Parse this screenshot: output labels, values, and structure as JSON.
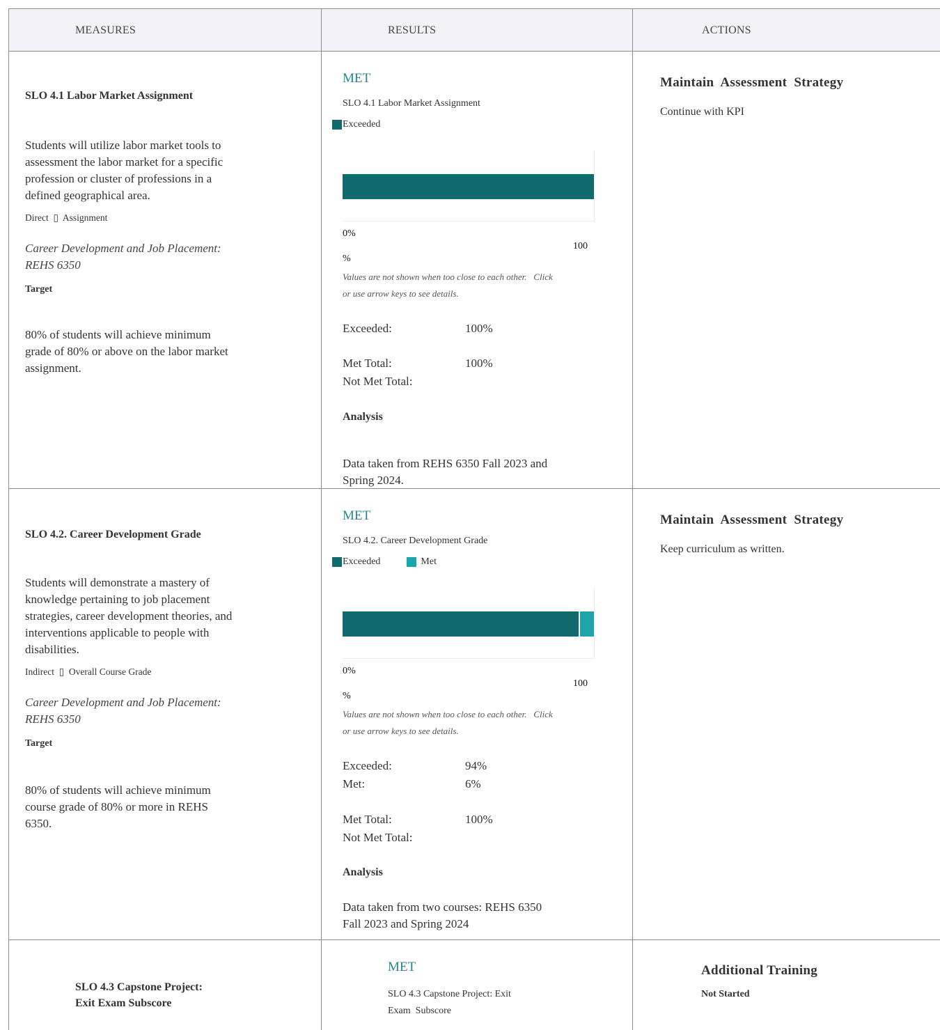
{
  "header": {
    "measures": "MEASURES",
    "results": "RESULTS",
    "actions": "ACTIONS"
  },
  "colors": {
    "exceeded": "#106a6e",
    "met": "#1fa3ab",
    "status": "#22888f"
  },
  "rows": [
    {
      "slo_title": "SLO 4.1 Labor Market Assignment",
      "description_lines": [
        "Students will utilize labor market tools to",
        "assessment the labor market for a specific",
        "profession or cluster of professions in a",
        "defined geographical area."
      ],
      "method": "Direct  ▯  Assignment",
      "course_lines": [
        "Career Development and Job Placement:",
        "REHS 6350"
      ],
      "target_label": "Target",
      "target_lines": [
        "80% of students will achieve minimum",
        "grade of 80% or above on the labor market",
        "assignment."
      ],
      "status": "MET",
      "chart_title": "SLO 4.1 Labor Market Assignment",
      "legend": [
        "Exceeded"
      ],
      "note_lines": [
        "Values are not shown when too close to each other.   Click",
        "or use arrow keys to see details."
      ],
      "stats": [
        {
          "label": "Exceeded:",
          "value": "100%"
        }
      ],
      "met_total_label": "Met Total:",
      "met_total_value": "100%",
      "not_met_label": "Not Met Total:",
      "analysis_label": "Analysis",
      "analysis_lines": [
        "Data taken from REHS 6350 Fall 2023 and",
        "Spring 2024."
      ],
      "action_title": "Maintain  Assessment  Strategy",
      "action_text": "Continue with KPI"
    },
    {
      "slo_title": "SLO 4.2. Career Development Grade",
      "description_lines": [
        "Students will demonstrate a mastery of",
        "knowledge pertaining to job placement",
        "strategies, career development theories, and",
        "interventions applicable to people with",
        "disabilities."
      ],
      "method": "Indirect  ▯  Overall Course Grade",
      "course_lines": [
        "Career Development and Job Placement:",
        "REHS 6350"
      ],
      "target_label": "Target",
      "target_lines": [
        "80% of students will achieve minimum",
        "course grade of 80% or more in REHS",
        "6350."
      ],
      "status": "MET",
      "chart_title": "SLO 4.2. Career Development Grade",
      "legend": [
        "Exceeded",
        "Met"
      ],
      "note_lines": [
        "Values are not shown when too close to each other.   Click",
        "or use arrow keys to see details."
      ],
      "stats": [
        {
          "label": "Exceeded:",
          "value": "94%"
        },
        {
          "label": "Met:",
          "value": "6%"
        }
      ],
      "met_total_label": "Met Total:",
      "met_total_value": "100%",
      "not_met_label": "Not Met Total:",
      "analysis_label": "Analysis",
      "analysis_lines": [
        "Data taken from two courses: REHS 6350",
        "Fall 2023 and Spring 2024"
      ],
      "action_title": "Maintain  Assessment  Strategy",
      "action_text": "Keep curriculum as written."
    },
    {
      "slo_title_lines": [
        "SLO 4.3 Capstone Project:",
        "Exit Exam Subscore"
      ],
      "status": "MET",
      "chart_title_lines": [
        "SLO 4.3 Capstone Project: Exit",
        "Exam  Subscore"
      ],
      "action_title": "Additional Training",
      "action_status": "Not Started"
    }
  ],
  "chart_data": [
    {
      "type": "bar",
      "title": "SLO 4.1 Labor Market Assignment",
      "orientation": "horizontal-stacked",
      "series": [
        {
          "name": "Exceeded",
          "values": [
            100
          ]
        }
      ],
      "xlim": [
        0,
        100
      ],
      "tick_labels": [
        "0%",
        "100%"
      ],
      "xlabel": "",
      "ylabel": ""
    },
    {
      "type": "bar",
      "title": "SLO 4.2. Career Development Grade",
      "orientation": "horizontal-stacked",
      "series": [
        {
          "name": "Exceeded",
          "values": [
            94
          ]
        },
        {
          "name": "Met",
          "values": [
            6
          ]
        }
      ],
      "xlim": [
        0,
        100
      ],
      "tick_labels": [
        "0%",
        "100%"
      ],
      "xlabel": "",
      "ylabel": ""
    }
  ]
}
